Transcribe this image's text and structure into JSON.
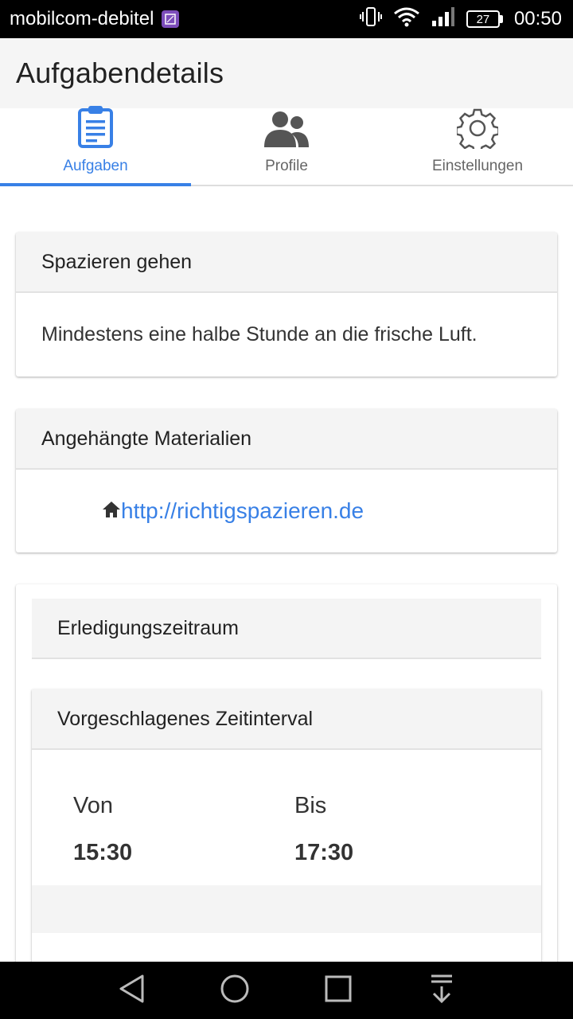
{
  "status_bar": {
    "carrier": "mobilcom-debitel",
    "battery": "27",
    "time": "00:50"
  },
  "app_bar": {
    "title": "Aufgabendetails"
  },
  "tabs": [
    {
      "label": "Aufgaben",
      "icon": "clipboard-icon",
      "active": true
    },
    {
      "label": "Profile",
      "icon": "people-icon",
      "active": false
    },
    {
      "label": "Einstellungen",
      "icon": "gear-icon",
      "active": false
    }
  ],
  "task": {
    "title": "Spazieren gehen",
    "description": "Mindestens eine halbe Stunde an die frische Luft."
  },
  "materials": {
    "title": "Angehängte Materialien",
    "link_icon": "home-icon",
    "link": "http://richtigspazieren.de"
  },
  "completion": {
    "title": "Erledigungszeitraum",
    "interval": {
      "title": "Vorgeschlagenes Zeitinterval",
      "from_label": "Von",
      "from_value": "15:30",
      "to_label": "Bis",
      "to_value": "17:30"
    }
  },
  "colors": {
    "accent": "#3880e6",
    "header_bg": "#f4f4f4"
  }
}
